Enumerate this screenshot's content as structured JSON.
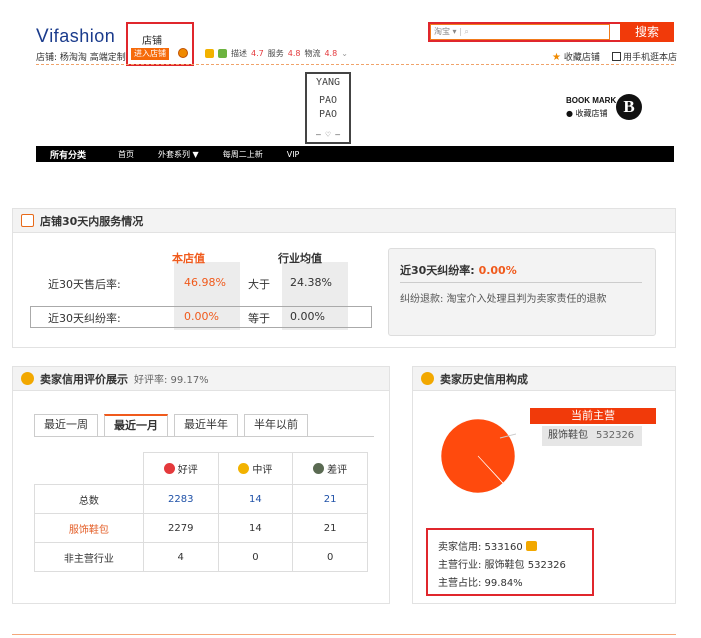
{
  "header": {
    "logo_text": "ifashion",
    "logo_v": "V",
    "shop_line": "店铺: 杨淘淘 高端定制",
    "shop_label": "店铺",
    "enter_shop": "进入店铺",
    "ratings": {
      "desc_label": "描述",
      "desc_val": "4.7",
      "service_label": "服务",
      "service_val": "4.8",
      "ship_label": "物流",
      "ship_val": "4.8"
    },
    "search": {
      "scope": "淘宝 ▾",
      "placeholder": "",
      "button": "搜索"
    },
    "fav_store": "收藏店铺",
    "mobile_store": "用手机逛本店"
  },
  "brand": {
    "logo_lines": [
      "YANG",
      "PAO",
      "PAO"
    ],
    "bookmark_title": "BOOK MARK",
    "bookmark_sub": "收藏店铺",
    "b_letter": "B"
  },
  "nav": {
    "items": [
      "所有分类",
      "首页",
      "外套系列 ▼",
      "每周二上新",
      "VIP"
    ]
  },
  "service": {
    "title": "店铺30天内服务情况",
    "col_store": "本店值",
    "col_avg": "行业均值",
    "rows": [
      {
        "label": "近30天售后率:",
        "store": "46.98%",
        "cmp": "大于",
        "avg": "24.38%"
      },
      {
        "label": "近30天纠纷率:",
        "store": "0.00%",
        "cmp": "等于",
        "avg": "0.00%"
      }
    ],
    "dispute_title": "近30天纠纷率:",
    "dispute_value": "0.00%",
    "dispute_desc": "纠纷退款: 淘宝介入处理且判为卖家责任的退款"
  },
  "credit": {
    "title": "卖家信用评价展示",
    "good_rate": "好评率: 99.17%",
    "tabs": [
      "最近一周",
      "最近一月",
      "最近半年",
      "半年以前"
    ],
    "active_tab": 1,
    "headers": [
      "好评",
      "中评",
      "差评"
    ],
    "rows": [
      {
        "label": "总数",
        "good": "2283",
        "mid": "14",
        "bad": "21"
      },
      {
        "label": "服饰鞋包",
        "good": "2279",
        "mid": "14",
        "bad": "21"
      },
      {
        "label": "非主营行业",
        "good": "4",
        "mid": "0",
        "bad": "0"
      }
    ]
  },
  "history": {
    "title": "卖家历史信用构成",
    "current_main": "当前主营",
    "main_cat": "服饰鞋包",
    "main_cat_num": "532326",
    "info": [
      "卖家信用: 533160",
      "主营行业: 服饰鞋包 532326",
      "主营占比: 99.84%"
    ],
    "main_share": 0.9984,
    "colors": {
      "pie_main": "#ff4a0d",
      "pie_other": "#f9b28a"
    }
  }
}
